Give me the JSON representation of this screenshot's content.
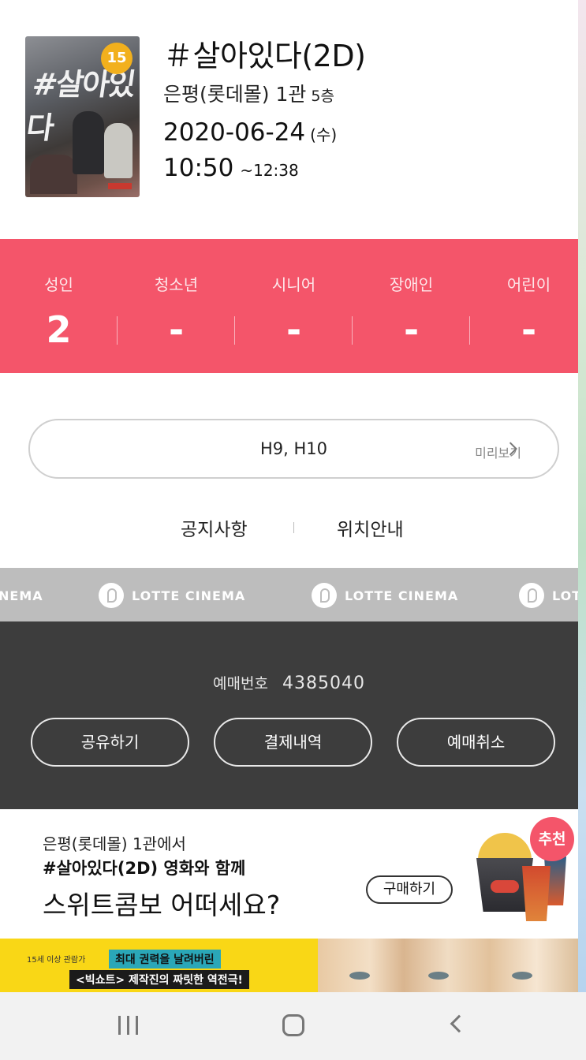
{
  "movie": {
    "rating": "15",
    "poster_title": "#살아있다",
    "title": "＃살아있다(2D)",
    "theater": "은평(롯데몰) 1관",
    "floor": "5층",
    "date": "2020-06-24",
    "day_of_week": "(수)",
    "start_time": "10:50",
    "end_time": "~12:38",
    "rating_color": "#f2b01d"
  },
  "audience": {
    "accent_color": "#f4556a",
    "types": [
      {
        "label": "성인",
        "count": "2"
      },
      {
        "label": "청소년",
        "count": "-"
      },
      {
        "label": "시니어",
        "count": "-"
      },
      {
        "label": "장애인",
        "count": "-"
      },
      {
        "label": "어린이",
        "count": "-"
      }
    ]
  },
  "seats": {
    "value": "H9, H10",
    "preview_label": "미리보기"
  },
  "links": {
    "notice": "공지사항",
    "location": "위치안내"
  },
  "brand": {
    "text": "LOTTE CINEMA",
    "partial_left": "NEMA",
    "partial_right": "LOT"
  },
  "booking": {
    "number_label": "예매번호",
    "number": "4385040",
    "share_label": "공유하기",
    "payment_label": "결제내역",
    "cancel_label": "예매취소"
  },
  "combo": {
    "line1": "은평(롯데몰) 1관에서",
    "line2": "#살아있다(2D) 영화와 함께",
    "line3": "스위트콤보 어떠세요?",
    "buy_label": "구매하기",
    "recommend_badge": "추천"
  },
  "ad": {
    "age_note": "15세 이상 관람가",
    "headline1": "최대 권력을 날려버린",
    "headline2": "<빅쇼트> 제작진의 짜릿한 역전극!"
  }
}
